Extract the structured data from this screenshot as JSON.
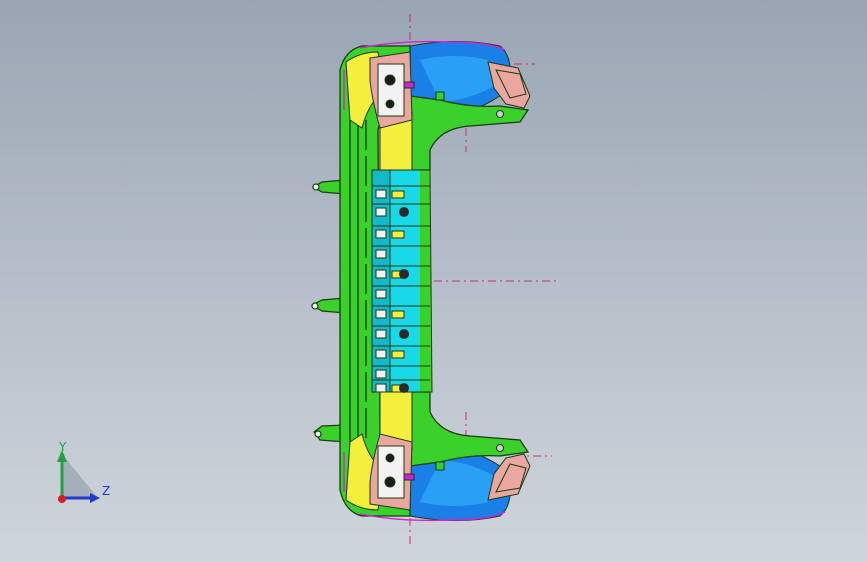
{
  "viewport": {
    "background_top": "#9aa5b3",
    "background_bottom": "#cfd5dc"
  },
  "model": {
    "colors": {
      "frame_green": "#3ad12a",
      "outline": "#1b3a14",
      "cyan_channels": "#19d8e8",
      "yellow_fill": "#f4ee3c",
      "blue_housing": "#1a7fe6",
      "pink_fill": "#e9a7a0",
      "magenta": "#d222d2",
      "white_clips": "#f2f2f2",
      "centerline": "#d22a6e"
    }
  },
  "triad": {
    "y_label": "Y",
    "z_label": "Z",
    "y_color": "#20a040",
    "z_color": "#1e3cc8",
    "origin_color": "#d42020"
  }
}
